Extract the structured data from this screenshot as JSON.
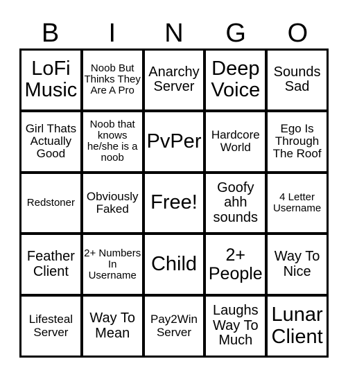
{
  "header": [
    "B",
    "I",
    "N",
    "G",
    "O"
  ],
  "cells": [
    {
      "text": "LoFi Music",
      "size": "s5"
    },
    {
      "text": "Noob But Thinks They Are A Pro",
      "size": "s1"
    },
    {
      "text": "Anarchy Server",
      "size": "s3"
    },
    {
      "text": "Deep Voice",
      "size": "s5"
    },
    {
      "text": "Sounds Sad",
      "size": "s3"
    },
    {
      "text": "Girl Thats Actually Good",
      "size": "s2"
    },
    {
      "text": "Noob that knows he/she is a noob",
      "size": "s1"
    },
    {
      "text": "PvPer",
      "size": "s5"
    },
    {
      "text": "Hardcore World",
      "size": "s2"
    },
    {
      "text": "Ego Is Through The Roof",
      "size": "s2"
    },
    {
      "text": "Redstoner",
      "size": "s1"
    },
    {
      "text": "Obviously Faked",
      "size": "s2"
    },
    {
      "text": "Free!",
      "size": "s5"
    },
    {
      "text": "Goofy ahh sounds",
      "size": "s3"
    },
    {
      "text": "4 Letter Username",
      "size": "s1"
    },
    {
      "text": "Feather Client",
      "size": "s3"
    },
    {
      "text": "2+ Numbers In Username",
      "size": "s1"
    },
    {
      "text": "Child",
      "size": "s5"
    },
    {
      "text": "2+ People",
      "size": "s4"
    },
    {
      "text": "Way To Nice",
      "size": "s3"
    },
    {
      "text": "Lifesteal Server",
      "size": "s2"
    },
    {
      "text": "Way To Mean",
      "size": "s3"
    },
    {
      "text": "Pay2Win Server",
      "size": "s2"
    },
    {
      "text": "Laughs Way To Much",
      "size": "s3"
    },
    {
      "text": "Lunar Client",
      "size": "s5"
    }
  ]
}
